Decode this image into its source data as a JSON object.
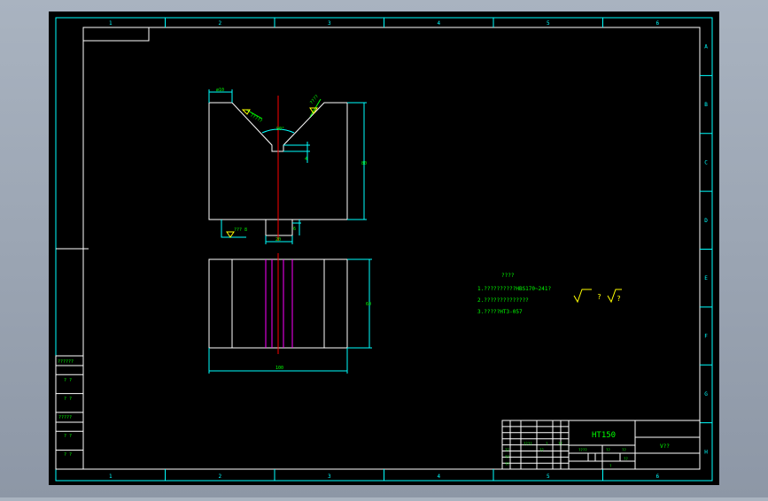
{
  "colors": {
    "background": "#000000",
    "frame": "#00ffff",
    "geometry": "#ffffff",
    "dimension": "#00ff00",
    "centerline": "#ff0000",
    "hidden_line": "#ff00ff",
    "roughness_symbol": "#ffff00"
  },
  "border": {
    "top_zones": [
      "1",
      "2",
      "3",
      "4",
      "5",
      "6"
    ],
    "bottom_zones": [
      "1",
      "2",
      "3",
      "4",
      "5",
      "6"
    ],
    "right_zones": [
      "A",
      "B",
      "C",
      "D",
      "E",
      "F",
      "G",
      "H"
    ]
  },
  "drawing": {
    "dims": {
      "top_left_width": "ø10",
      "left_chamfer": "?????",
      "right_chamfer": "????",
      "v_angle": "90°",
      "slot_depth": "4",
      "total_height": "80",
      "bottom_left_note": "??? 8",
      "bottom_slot_width": "20",
      "bottom_slot_depth": "6",
      "side_view_height": "60",
      "side_view_width": "100"
    }
  },
  "notes": {
    "title": "????",
    "lines": [
      "1.??????????HBS170~241?",
      "2.??????????????",
      "3.?????HT3-057"
    ]
  },
  "roughness": {
    "label_1": "?",
    "label_2": "?"
  },
  "left_strip": {
    "cells": [
      "??????",
      "? ?",
      "? ?",
      "?????",
      "? ?",
      "? ?"
    ]
  },
  "title_block": {
    "material": "HT150",
    "drawing_name": "V??",
    "cells": [
      "??",
      "??",
      "????",
      "??",
      "?",
      "??",
      "??",
      "????",
      "??",
      "??",
      "??",
      "?"
    ]
  }
}
